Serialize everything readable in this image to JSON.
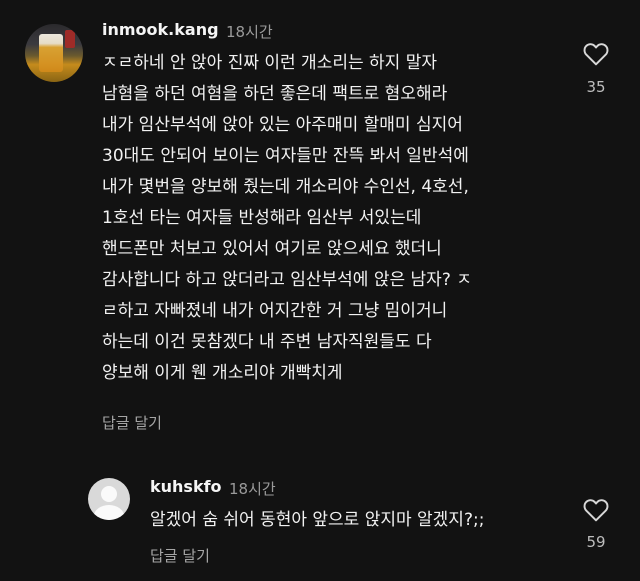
{
  "comments": [
    {
      "username": "inmook.kang",
      "time": "18시간",
      "lines": [
        "ㅈㄹ하네 안 앉아 진짜 이런 개소리는 하지 말자",
        "남혐을 하던 여혐을 하던 좋은데 팩트로 혐오해라",
        "내가 임산부석에 앉아 있는 아주매미 할매미 심지어",
        "30대도 안되어 보이는 여자들만 잔뜩 봐서 일반석에",
        "내가 몇번을 양보해 줬는데 개소리야 수인선, 4호선,",
        "1호선 타는 여자들 반성해라 임산부 서있는데",
        "핸드폰만 처보고 있어서 여기로 앉으세요 했더니",
        "감사합니다 하고 앉더라고 임산부석에 앉은 남자? ㅈ",
        "ㄹ하고 자빠졌네 내가 어지간한 거 그냥 밈이거니",
        "하는데 이건 못참겠다 내 주변 남자직원들도 다",
        "양보해 이게 웬 개소리야 개빡치게"
      ],
      "reply_label": "답글 달기",
      "likes": "35"
    },
    {
      "username": "kuhskfo",
      "time": "18시간",
      "lines": [
        "알겠어 숨 쉬어 동현아 앞으로 앉지마 알겠지?;;"
      ],
      "reply_label": "답글 달기",
      "likes": "59"
    }
  ]
}
